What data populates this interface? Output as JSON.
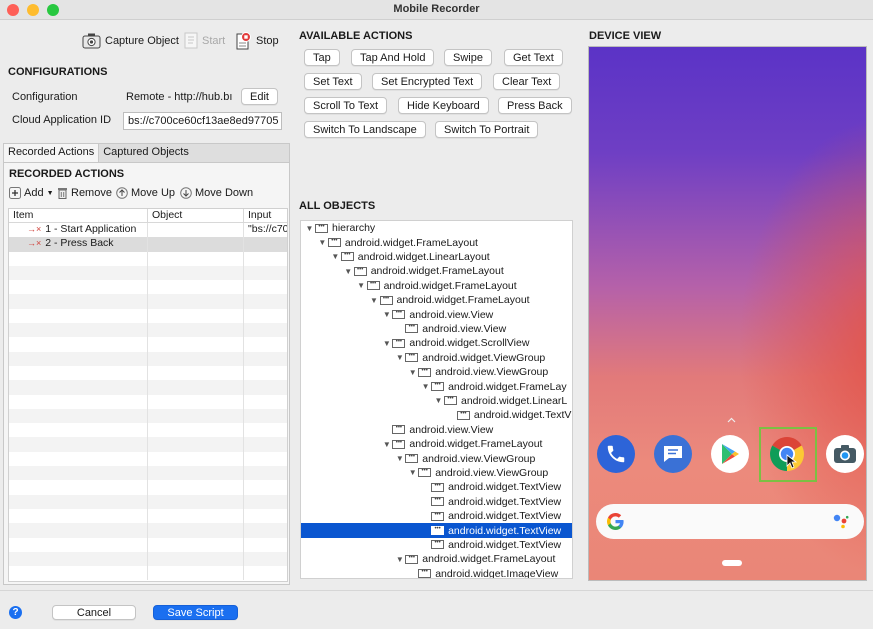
{
  "window": {
    "title": "Mobile Recorder"
  },
  "toolbar": {
    "capture": "Capture Object",
    "start": "Start",
    "stop": "Stop"
  },
  "config": {
    "header": "CONFIGURATIONS",
    "configuration_label": "Configuration",
    "configuration_value": "Remote - http://hub.bı",
    "edit": "Edit",
    "cloud_label": "Cloud Application ID",
    "cloud_value": "bs://c700ce60cf13ae8ed97705"
  },
  "tabs": {
    "recorded": "Recorded Actions",
    "captured": "Captured Objects"
  },
  "recorded": {
    "header": "RECORDED ACTIONS",
    "add": "Add",
    "remove": "Remove",
    "move_up": "Move Up",
    "move_down": "Move Down",
    "columns": [
      "Item",
      "Object",
      "Input"
    ],
    "rows": [
      {
        "item": "1 - Start Application",
        "object": "",
        "input": "\"bs://c70"
      },
      {
        "item": "2 - Press Back",
        "object": "",
        "input": ""
      }
    ]
  },
  "actions": {
    "header": "AVAILABLE ACTIONS",
    "items": [
      "Tap",
      "Tap And Hold",
      "Swipe",
      "Get Text",
      "Set Text",
      "Set Encrypted Text",
      "Clear Text",
      "Scroll To Text",
      "Hide Keyboard",
      "Press Back",
      "Switch To Landscape",
      "Switch To Portrait"
    ]
  },
  "objects": {
    "header": "ALL OBJECTS",
    "nodes": [
      {
        "label": "hierarchy",
        "depth": 0
      },
      {
        "label": "android.widget.FrameLayout",
        "depth": 1
      },
      {
        "label": "android.widget.LinearLayout",
        "depth": 2
      },
      {
        "label": "android.widget.FrameLayout",
        "depth": 3
      },
      {
        "label": "android.widget.FrameLayout",
        "depth": 4
      },
      {
        "label": "android.widget.FrameLayout",
        "depth": 5
      },
      {
        "label": "android.view.View",
        "depth": 6
      },
      {
        "label": "android.view.View",
        "depth": 7
      },
      {
        "label": "android.widget.ScrollView",
        "depth": 6
      },
      {
        "label": "android.widget.ViewGroup",
        "depth": 7
      },
      {
        "label": "android.view.ViewGroup",
        "depth": 8
      },
      {
        "label": "android.widget.FrameLay",
        "depth": 9
      },
      {
        "label": "android.widget.LinearL",
        "depth": 10
      },
      {
        "label": "android.widget.TextV",
        "depth": 11
      },
      {
        "label": "android.view.View",
        "depth": 6
      },
      {
        "label": "android.widget.FrameLayout",
        "depth": 6
      },
      {
        "label": "android.view.ViewGroup",
        "depth": 7
      },
      {
        "label": "android.view.ViewGroup",
        "depth": 8
      },
      {
        "label": "android.widget.TextView",
        "depth": 9
      },
      {
        "label": "android.widget.TextView",
        "depth": 9
      },
      {
        "label": "android.widget.TextView",
        "depth": 9
      },
      {
        "label": "android.widget.TextView",
        "depth": 9
      },
      {
        "label": "android.widget.TextView",
        "depth": 9
      },
      {
        "label": "android.widget.FrameLayout",
        "depth": 7
      },
      {
        "label": "android.widget.ImageView",
        "depth": 8
      }
    ],
    "selected_index": 21
  },
  "device": {
    "header": "DEVICE VIEW"
  },
  "footer": {
    "cancel": "Cancel",
    "save": "Save Script",
    "help": "?"
  },
  "colors": {
    "accent": "#1a6ff0",
    "selection": "#0a56d0",
    "highlight": "#7bc043"
  }
}
